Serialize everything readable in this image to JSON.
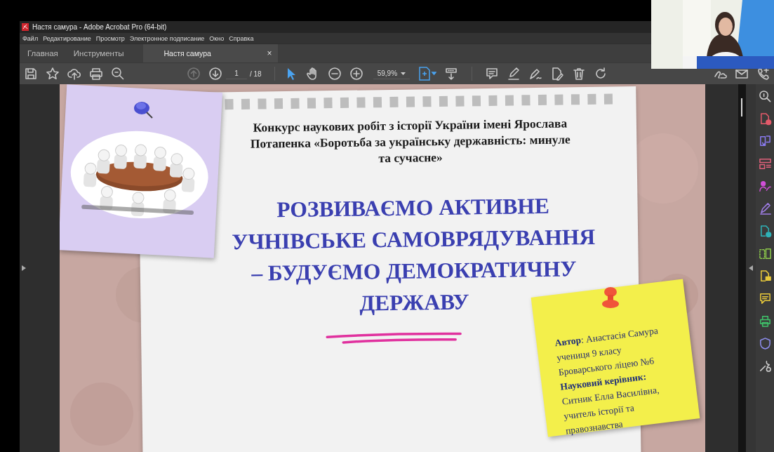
{
  "window": {
    "title": "Настя самура - Adobe Acrobat Pro (64-bit)"
  },
  "menu": [
    "Файл",
    "Редактирование",
    "Просмотр",
    "Электронное подписание",
    "Окно",
    "Справка"
  ],
  "tabs": [
    {
      "label": "Главная",
      "selected": false
    },
    {
      "label": "Инструменты",
      "selected": false
    },
    {
      "label": "Настя самура",
      "selected": true,
      "close_label": "×"
    }
  ],
  "toolbar": {
    "page_current": "1",
    "page_total": "/ 18",
    "zoom": "59,9%"
  },
  "slide": {
    "heading": "Конкурс наукових робіт з історії України імені Ярослава Потапенка «Боротьба за українську державність: минуле та сучасне»",
    "title_lines": [
      "РОЗВИВАЄМО АКТИВНЕ",
      "УЧНІВСЬКЕ САМОВРЯДУВАННЯ",
      "– БУДУЄМО ДЕМОКРАТИЧНУ",
      "ДЕРЖАВУ"
    ],
    "note_lines": [
      {
        "kind": "text",
        "text": "**Автор**: Анастасія Самура"
      },
      {
        "kind": "text",
        "text": "учениця 9 класу"
      },
      {
        "kind": "text",
        "text": "Броварського ліцею №6"
      },
      {
        "kind": "heading",
        "text": "Науковий керівник:"
      },
      {
        "kind": "text",
        "text": "Ситник Елла Василівна,"
      },
      {
        "kind": "text",
        "text": "учитель історії та"
      },
      {
        "kind": "text",
        "text": "правознавства"
      }
    ]
  }
}
